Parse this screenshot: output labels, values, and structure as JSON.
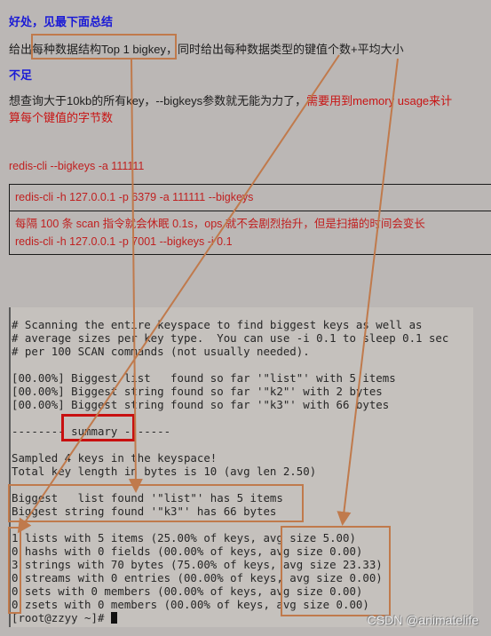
{
  "doc": {
    "heading_benefit": "好处，见最下面总结",
    "benefit_text_pre": "给出",
    "benefit_text_boxed": "每种数据结构Top 1 bigkey",
    "benefit_text_post": "，同时给出每种数据类型的键值个数+平均大小",
    "heading_shortcoming": "不足",
    "shortcoming_text": "想查询大于10kb的所有key，--bigkeys参数就无能为力了，",
    "shortcoming_red_line1": "需要用到memory usage来计",
    "shortcoming_red_line2": "算每个键值的字节数",
    "cmd_simple": "redis-cli --bigkeys -a 111111",
    "table_rows": [
      {
        "line1": "redis-cli -h 127.0.0.1 -p 6379 -a 111111 --bigkeys"
      },
      {
        "line1": "每隔 100 条 scan 指令就会休眠 0.1s，ops 就不会剧烈抬升，但是扫描的时间会变长",
        "line2": "redis-cli -h 127.0.0.1 -p 7001 --bigkeys -i 0.1"
      }
    ]
  },
  "terminal": {
    "header_lines": [
      "# Scanning the entire keyspace to find biggest keys as well as",
      "# average sizes per key type.  You can use -i 0.1 to sleep 0.1 sec",
      "# per 100 SCAN commands (not usually needed)."
    ],
    "progress_lines": [
      "[00.00%] Biggest list   found so far '\"list\"' with 5 items",
      "[00.00%] Biggest string found so far '\"k2\"' with 2 bytes",
      "[00.00%] Biggest string found so far '\"k3\"' with 66 bytes"
    ],
    "summary_line": "-------- summary -------",
    "sampled_lines": [
      "Sampled 4 keys in the keyspace!",
      "Total key length in bytes is 10 (avg len 2.50)"
    ],
    "biggest_lines": [
      "Biggest   list found '\"list\"' has 5 items",
      "Biggest string found '\"k3\"' has 66 bytes"
    ],
    "type_lines": [
      "1 lists with 5 items (25.00% of keys, avg size 5.00)",
      "0 hashs with 0 fields (00.00% of keys, avg size 0.00)",
      "3 strings with 70 bytes (75.00% of keys, avg size 23.33)",
      "0 streams with 0 entries (00.00% of keys, avg size 0.00)",
      "0 sets with 0 members (00.00% of keys, avg size 0.00)",
      "0 zsets with 0 members (00.00% of keys, avg size 0.00)"
    ],
    "prompt": "[root@zzyy ~]# "
  },
  "watermark": "CSDN @animatelife",
  "colors": {
    "annotation_orange": "#c07a4c",
    "summary_red": "#c81010",
    "heading_blue": "#1a1ad6",
    "command_red": "#c02020"
  }
}
